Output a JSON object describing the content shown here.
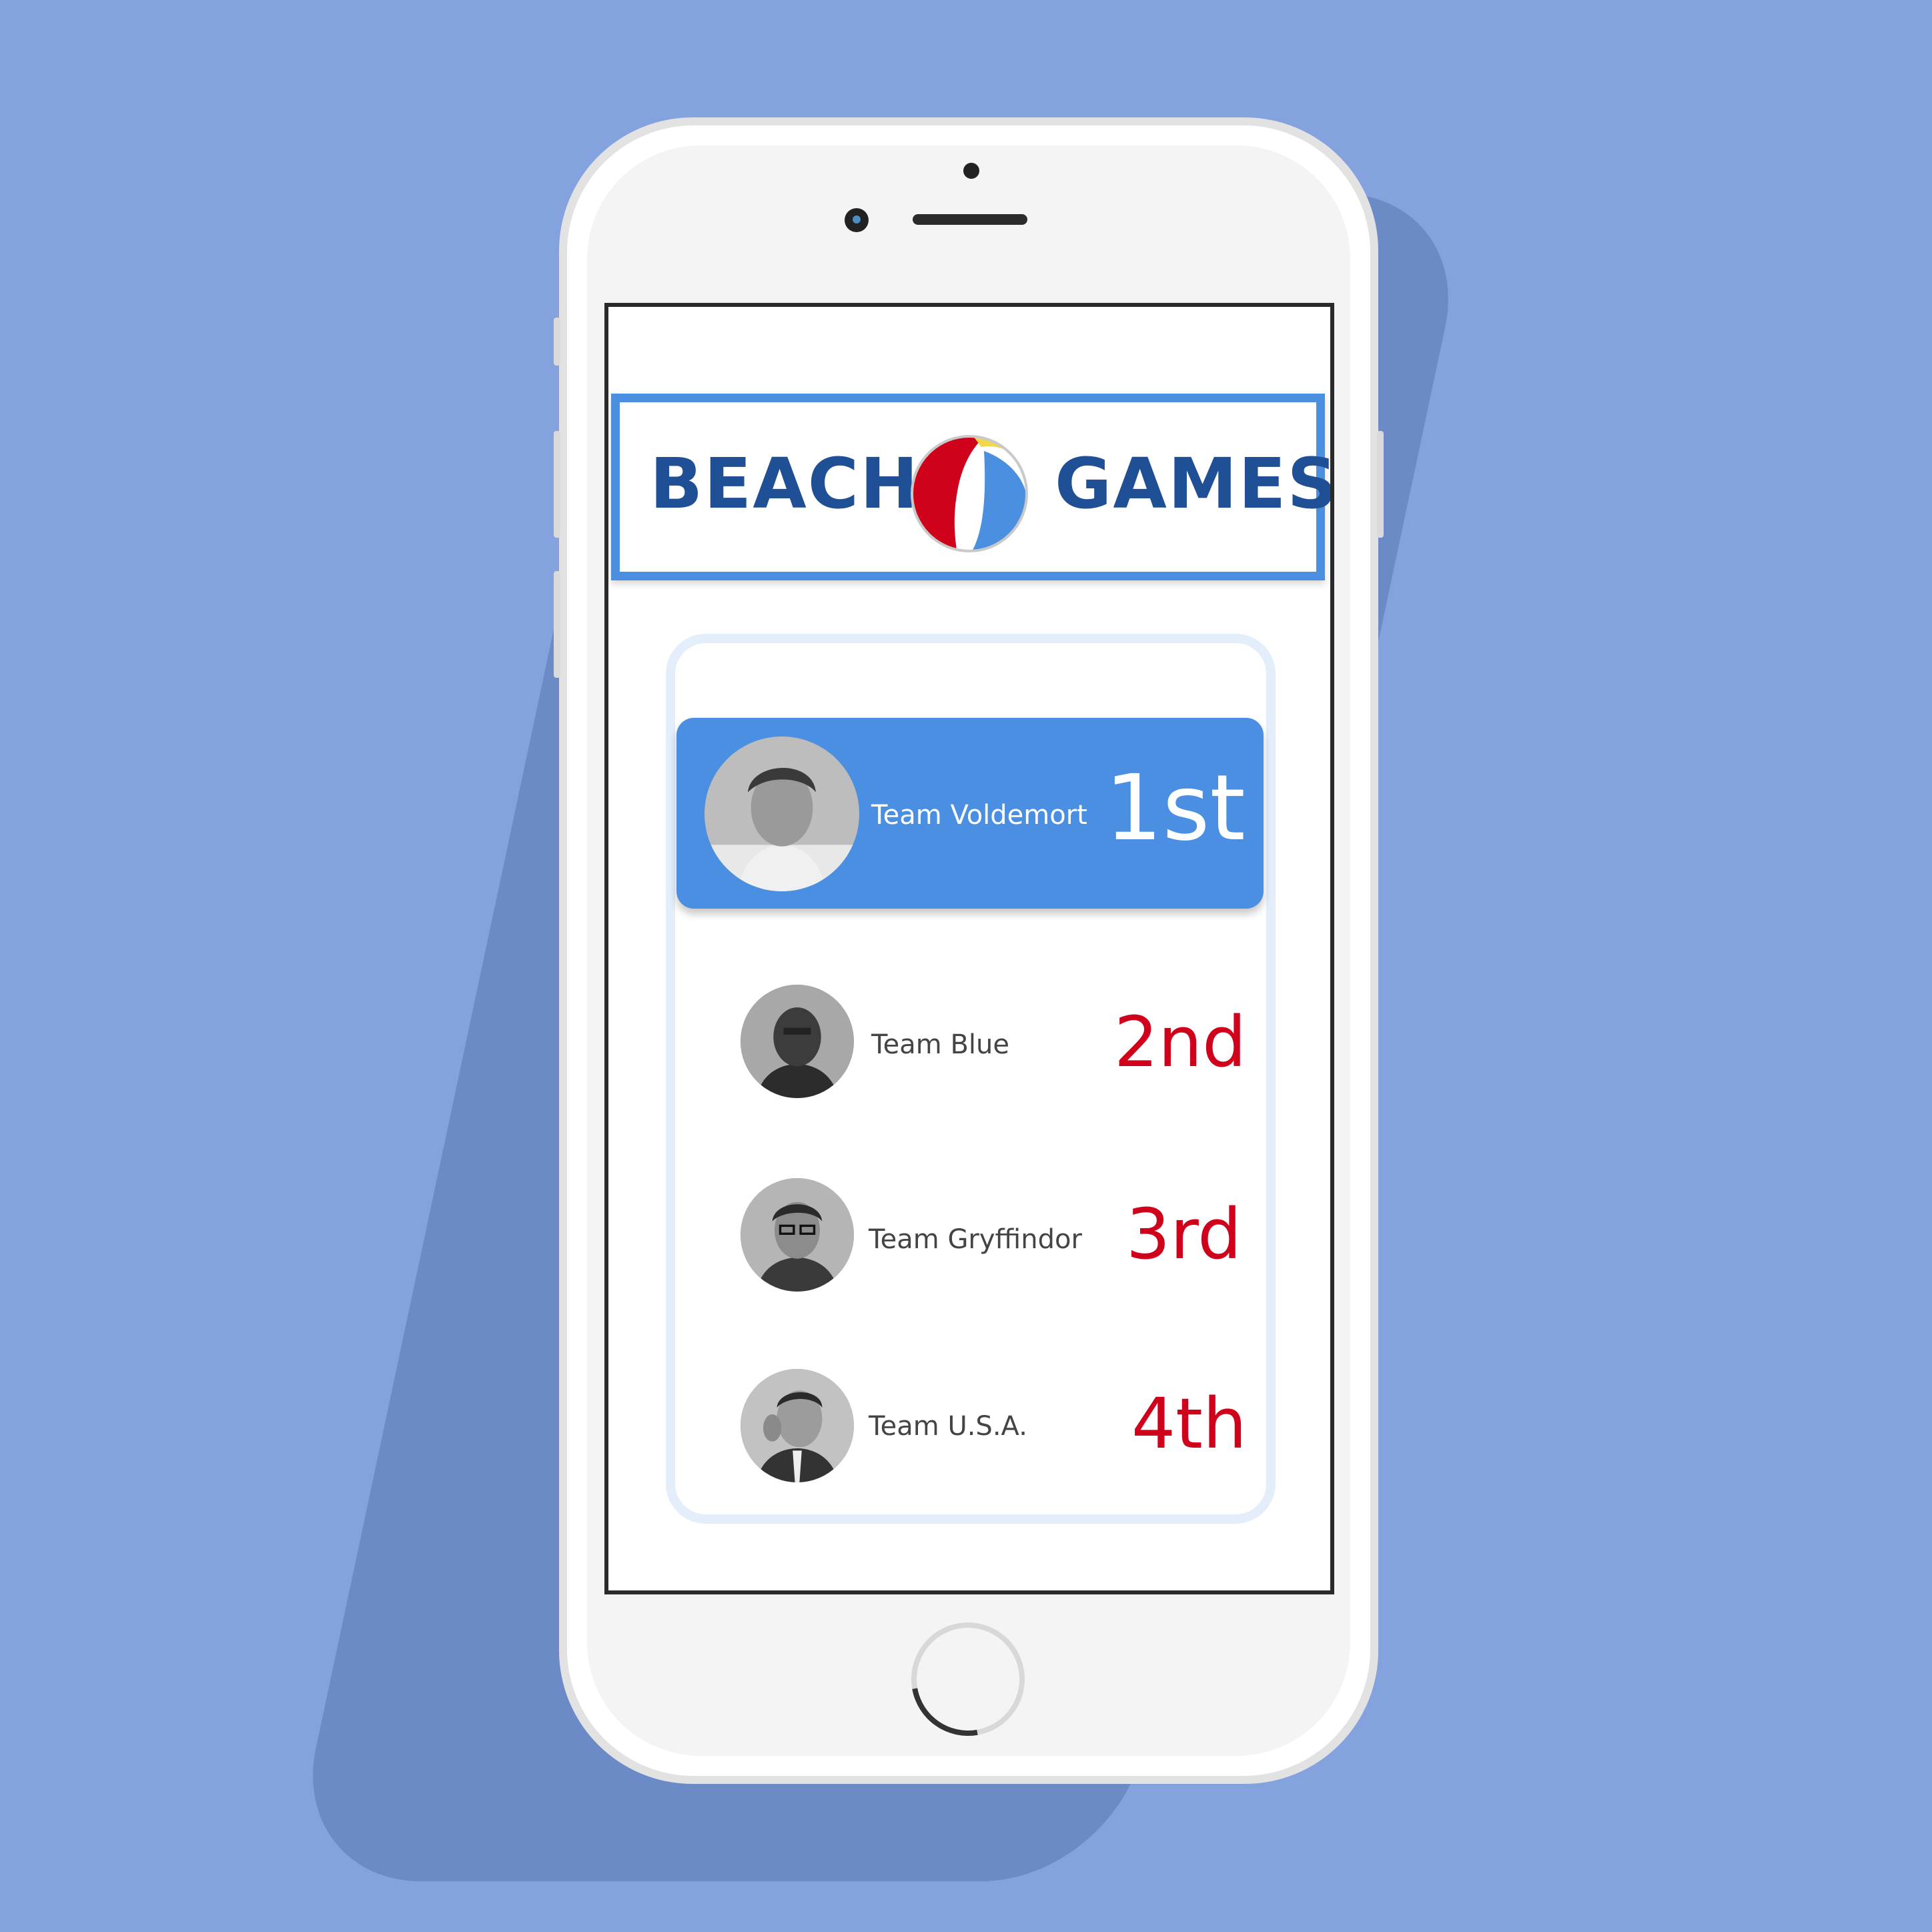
{
  "app": {
    "logo": {
      "left_word": "BEACH",
      "right_word": "GAMES",
      "ball_colors": {
        "red": "#d0021b",
        "blue": "#4a8fe0",
        "yellow": "#f2d64b",
        "white": "#ffffff"
      }
    },
    "accent_color": "#4b8fe2",
    "rank_color": "#d0021b"
  },
  "leaderboard": {
    "teams": [
      {
        "name": "Team Voldemort",
        "rank": "1st",
        "highlighted": true,
        "avatar": "team-voldemort-avatar"
      },
      {
        "name": "Team Blue",
        "rank": "2nd",
        "highlighted": false,
        "avatar": "team-blue-avatar"
      },
      {
        "name": "Team Gryffindor",
        "rank": "3rd",
        "highlighted": false,
        "avatar": "team-gryffindor-avatar"
      },
      {
        "name": "Team U.S.A.",
        "rank": "4th",
        "highlighted": false,
        "avatar": "team-usa-avatar"
      }
    ]
  }
}
